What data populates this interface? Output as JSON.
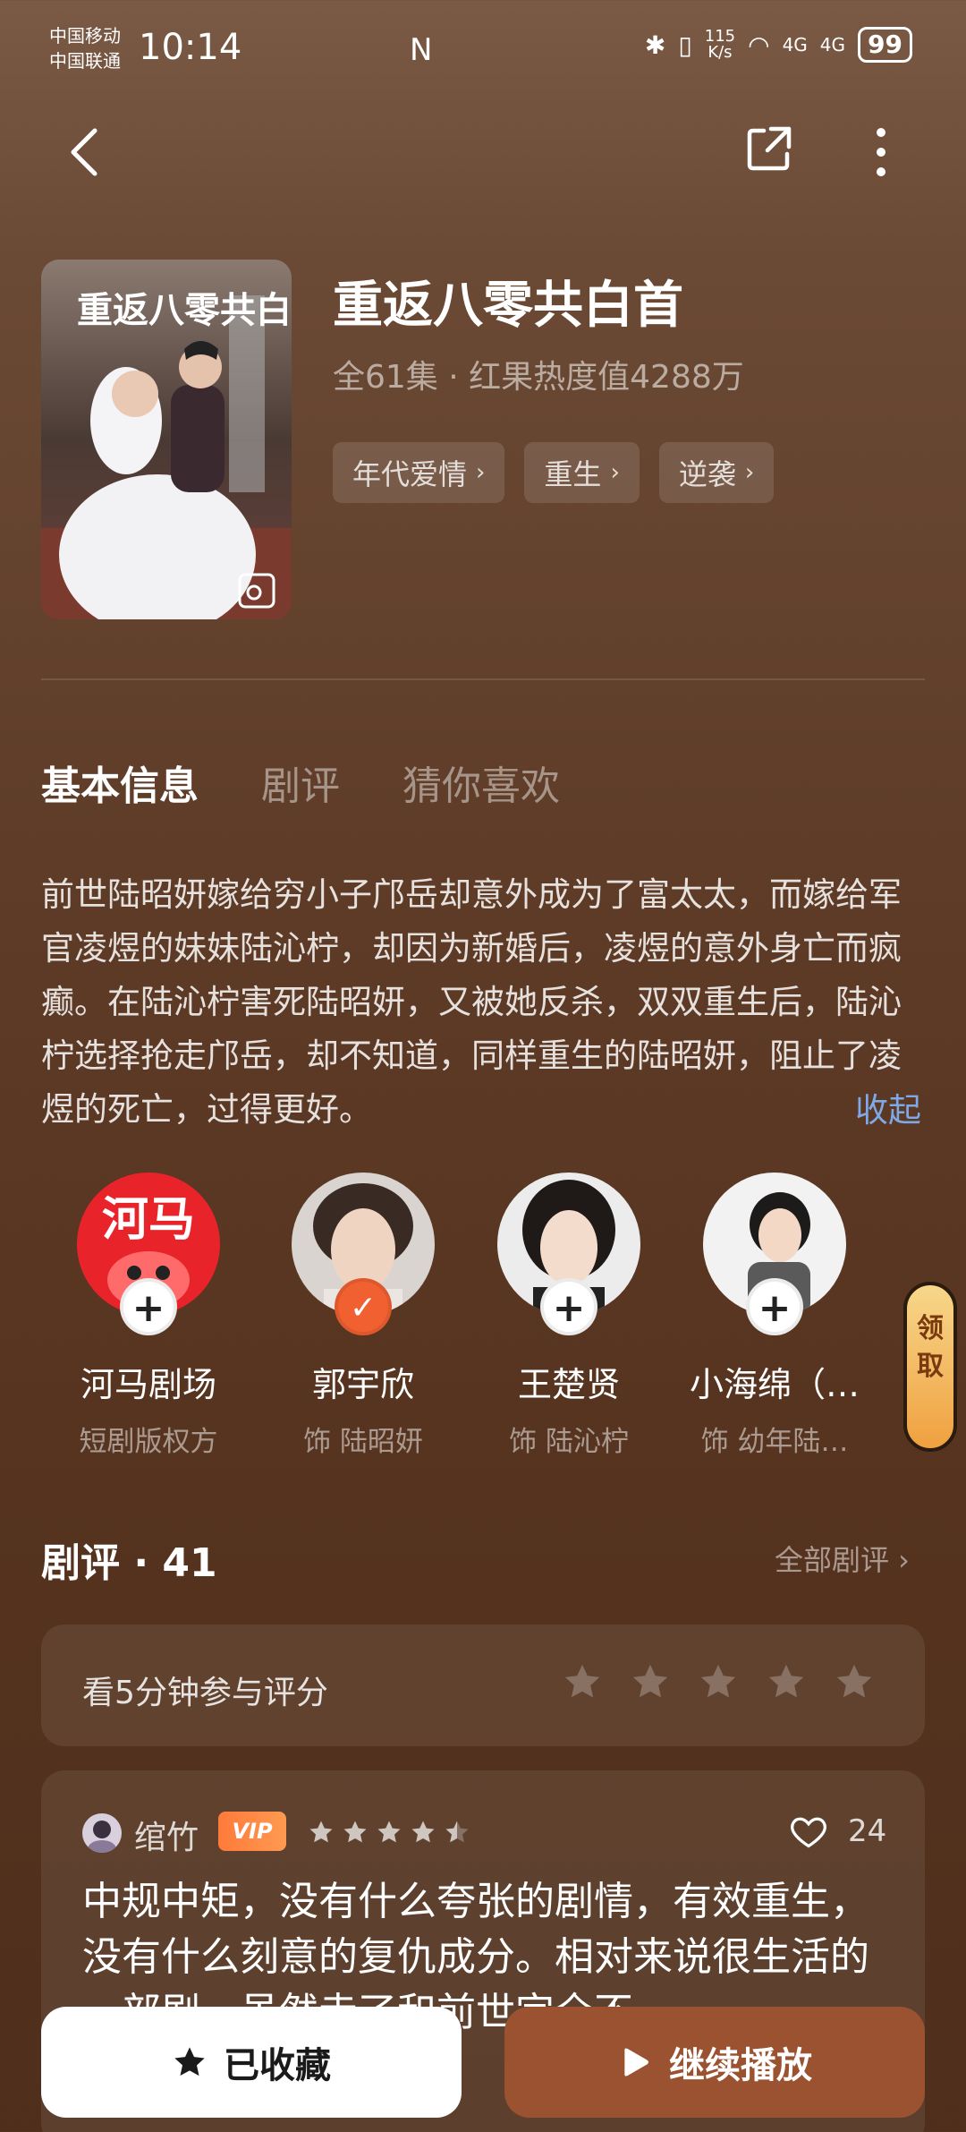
{
  "status_bar": {
    "carrier_1": "中国移动",
    "carrier_2": "中国联通",
    "time": "10:14",
    "nfc": "N",
    "net_speed_top": "115",
    "net_speed_bottom": "K/s",
    "signal_1": "4G",
    "signal_2": "4G",
    "battery": "99"
  },
  "drama": {
    "title": "重返八零共白首",
    "meta": "全61集 · 红果热度值4288万",
    "poster_text": "重返八零共白首",
    "tags": [
      "年代爱情",
      "重生",
      "逆袭"
    ]
  },
  "tabs": [
    "基本信息",
    "剧评",
    "猜你喜欢"
  ],
  "synopsis": "前世陆昭妍嫁给穷小子邝岳却意外成为了富太太，而嫁给军官凌煜的妹妹陆沁柠，却因为新婚后，凌煜的意外身亡而疯癫。在陆沁柠害死陆昭妍，又被她反杀，双双重生后，陆沁柠选择抢走邝岳，却不知道，同样重生的陆昭妍，阻止了凌煜的死亡，过得更好。",
  "collapse_label": "收起",
  "cast": [
    {
      "name": "河马剧场",
      "role": "短剧版权方",
      "logo_text": "河马",
      "followed": false
    },
    {
      "name": "郭宇欣",
      "role": "饰 陆昭妍",
      "followed": true
    },
    {
      "name": "王楚贤",
      "role": "饰 陆沁柠",
      "followed": false
    },
    {
      "name": "小海绵（…",
      "role": "饰 幼年陆…",
      "followed": false
    }
  ],
  "reward_label": [
    "领",
    "取"
  ],
  "reviews": {
    "header": "剧评 · 41",
    "all_label": "全部剧评 ›",
    "rate_prompt": "看5分钟参与评分",
    "rate_stars_total": 5,
    "item": {
      "user": "绾竹",
      "vip": "VIP",
      "rating": 4.5,
      "likes": "24",
      "text": "中规中矩，没有什么夸张的剧情，有效重生，没有什么刻意的复仇成分。相对来说很生活的一部剧，虽然走了和前世完全不"
    }
  },
  "bottom": {
    "favorite_label": "已收藏",
    "play_label": "继续播放"
  },
  "colors": {
    "accent_orange": "#f06030",
    "play_button": "#9b5230",
    "link_blue": "#7fa8e6"
  }
}
